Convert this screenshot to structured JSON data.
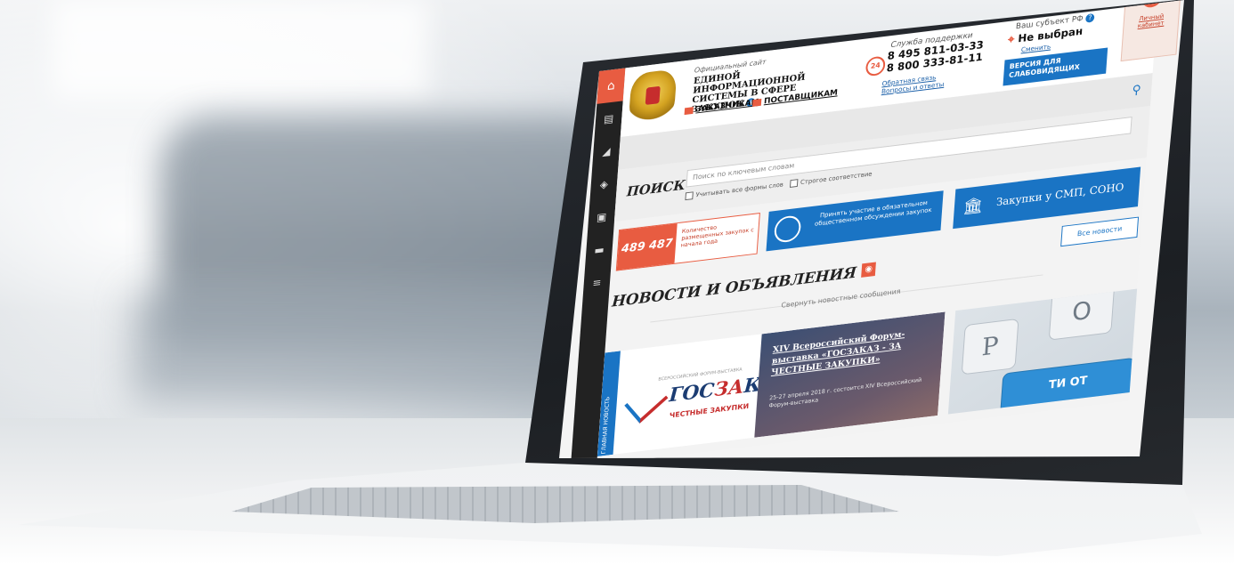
{
  "site": {
    "official_label": "Официальный сайт",
    "title": "ЕДИНОЙ ИНФОРМАЦИОННОЙ СИСТЕМЫ В СФЕРЕ ЗАКУПОК",
    "link_customers": "ЗАКАЗЧИКАМ",
    "link_suppliers": "ПОСТАВЩИКАМ"
  },
  "support": {
    "title": "Служба поддержки",
    "badge": "24",
    "phone_1": "8 495 811-03-33",
    "phone_2": "8 800 333-81-11",
    "feedback_line_1": "Обратная связь",
    "feedback_line_2": "Вопросы и ответы"
  },
  "region": {
    "title": "Ваш субъект РФ",
    "value": "Не выбран",
    "change_link": "Сменить"
  },
  "impaired_button": {
    "line_1": "ВЕРСИЯ ДЛЯ",
    "line_2": "СЛАБОВИДЯЩИХ"
  },
  "cabinet": {
    "label": "Личный кабинет"
  },
  "search": {
    "label": "ПОИСК",
    "placeholder": "Поиск по ключевым словам",
    "checkbox_1": "Учитывать все формы слов",
    "checkbox_2": "Строгое соответствие"
  },
  "cards": {
    "count_value": "489 487",
    "count_text": "Количество размещенных закупок с начала года",
    "discuss_text": "Принять участие в обязательном общественном обсуждении закупок",
    "smp_text": "Закупки у СМП, СОНО"
  },
  "news": {
    "heading": "НОВОСТИ И ОБЪЯВЛЕНИЯ",
    "all_news": "Все новости",
    "collapse": "Свернуть новостные сообщения",
    "ribbon": "ГЛАВНАЯ НОВОСТЬ",
    "gz_sub": "ВСЕРОССИЙСКИЙ ФОРУМ-ВЫСТАВКА",
    "gz_logo_a": "ГОС",
    "gz_logo_b": "ЗА",
    "gz_logo_c": "КАЗ",
    "gz_tag": "ЧЕСТНЫЕ ЗАКУПКИ",
    "forum_title": "XIV Всероссийский Форум-выставка «ГОСЗАКАЗ - ЗА ЧЕСТНЫЕ ЗАКУПКИ»",
    "forum_desc": "25-27 апреля 2018 г. состоится XIV Всероссийский Форум-выставка",
    "photo_key_1": "P",
    "photo_key_2": "O",
    "photo_key_3": "ТИ ОТ"
  },
  "colors": {
    "accent_orange": "#e85c41",
    "accent_blue": "#1a74c4",
    "nav_dark": "#222222"
  },
  "icons": {
    "home": "home-icon",
    "search": "search-icon",
    "rss": "rss-icon",
    "lock": "lock-icon",
    "bank": "bank-icon"
  }
}
